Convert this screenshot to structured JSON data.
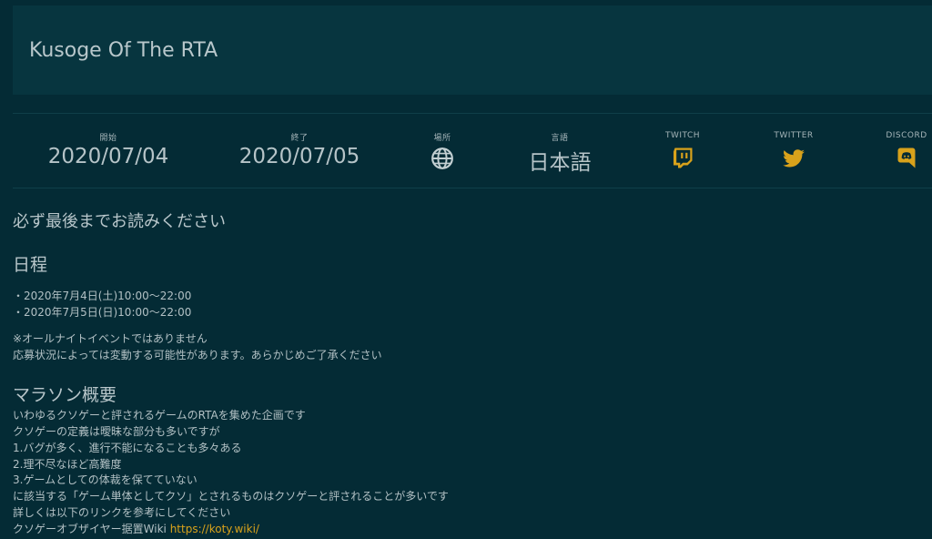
{
  "header": {
    "title": "Kusoge Of The RTA"
  },
  "info": {
    "start": {
      "label": "開始",
      "value": "2020/07/04"
    },
    "end": {
      "label": "終了",
      "value": "2020/07/05"
    },
    "location": {
      "label": "場所",
      "icon": "globe-icon"
    },
    "language": {
      "label": "言語",
      "value": "日本語"
    },
    "twitch": {
      "label": "TWITCH",
      "icon": "twitch-icon"
    },
    "twitter": {
      "label": "TWITTER",
      "icon": "twitter-icon"
    },
    "discord": {
      "label": "DISCORD",
      "icon": "discord-icon"
    }
  },
  "colors": {
    "background": "#042b35",
    "header_bg": "#07353f",
    "accent": "#d9a21b",
    "text": "#b6c4c8"
  },
  "content": {
    "notice": "必ず最後までお読みください",
    "schedule_heading": "日程",
    "schedule_items": [
      "・2020年7月4日(土)10:00～22:00",
      "・2020年7月5日(日)10:00～22:00"
    ],
    "schedule_notes": [
      "※オールナイトイベントではありません",
      "応募状況によっては変動する可能性があります。あらかじめご了承ください"
    ],
    "overview_heading": "マラソン概要",
    "overview_lines": [
      "いわゆるクソゲーと評されるゲームのRTAを集めた企画です",
      "クソゲーの定義は曖昧な部分も多いですが",
      "1.バグが多く、進行不能になることも多々ある",
      "2.理不尽なほど高難度",
      "3.ゲームとしての体裁を保てていない",
      "に該当する「ゲーム単体としてクソ」とされるものはクソゲーと評されることが多いです",
      "詳しくは以下のリンクを参考にしてください"
    ],
    "wiki_prefix": "クソゲーオブザイヤー据置Wiki ",
    "wiki_link": "https://koty.wiki/"
  }
}
